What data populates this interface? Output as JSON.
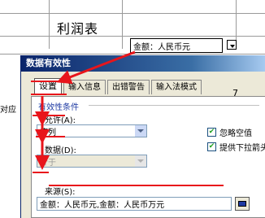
{
  "sheet": {
    "title": "利润表",
    "cell_value": "金额：人民币元",
    "left_cell_text": "对应",
    "side_number": "7"
  },
  "dialog": {
    "title": "数据有效性",
    "tabs": [
      {
        "label": "设置",
        "active": true
      },
      {
        "label": "输入信息",
        "active": false
      },
      {
        "label": "出错警告",
        "active": false
      },
      {
        "label": "输入法模式",
        "active": false
      }
    ],
    "group_label": "有效性条件",
    "allow_label": "允许(A):",
    "allow_value": "序列",
    "data_label": "数据(D):",
    "data_value": "介于",
    "ignore_blank_label": "忽略空值",
    "ignore_blank_checked": true,
    "provide_dropdown_label": "提供下拉箭头",
    "provide_dropdown_checked": true,
    "source_label": "来源(S):",
    "source_value": "金额：人民币元,金额：人民币万元"
  },
  "colors": {
    "annotation": "#e8151b",
    "title_bar": "#0a246a",
    "group_label": "#1f3ba3"
  }
}
